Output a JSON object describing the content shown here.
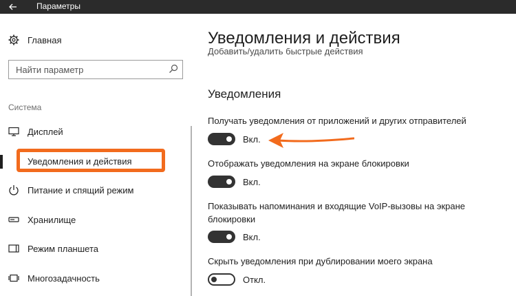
{
  "window": {
    "title": "Параметры"
  },
  "sidebar": {
    "home_label": "Главная",
    "search_placeholder": "Найти параметр",
    "section_title": "Система",
    "items": [
      {
        "label": "Дисплей",
        "icon": "display-icon"
      },
      {
        "label": "Уведомления и действия",
        "icon": "notifications-icon",
        "active": true
      },
      {
        "label": "Питание и спящий режим",
        "icon": "power-icon"
      },
      {
        "label": "Хранилище",
        "icon": "storage-icon"
      },
      {
        "label": "Режим планшета",
        "icon": "tablet-mode-icon"
      },
      {
        "label": "Многозадачность",
        "icon": "multitasking-icon"
      }
    ]
  },
  "main": {
    "page_title": "Уведомления и действия",
    "cut_text": "Добавить/удалить быстрые действия",
    "section_heading": "Уведомления",
    "settings": [
      {
        "label": "Получать уведомления от приложений и других отправителей",
        "state": "Вкл.",
        "on": true
      },
      {
        "label": "Отображать уведомления на экране блокировки",
        "state": "Вкл.",
        "on": true
      },
      {
        "label": "Показывать напоминания и входящие VoIP-вызовы на экране блокировки",
        "state": "Вкл.",
        "on": true
      },
      {
        "label": "Скрыть уведомления при дублировании моего экрана",
        "state": "Откл.",
        "on": false
      }
    ]
  },
  "colors": {
    "highlight": "#f26b1d",
    "titlebar": "#2b2b2b",
    "toggle_on": "#333333"
  }
}
